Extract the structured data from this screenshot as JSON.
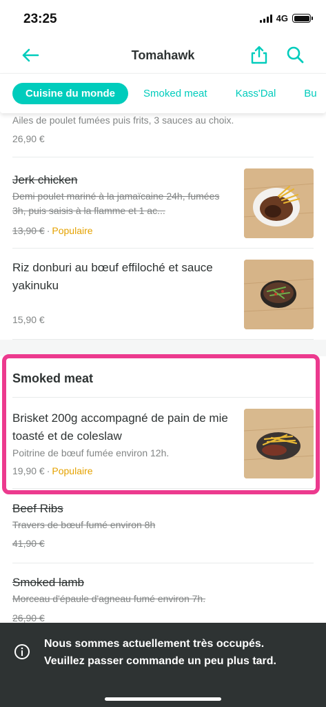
{
  "status_bar": {
    "time": "23:25",
    "network": "4G"
  },
  "header": {
    "title": "Tomahawk",
    "back_icon": "arrow-left-icon",
    "share_icon": "share-icon",
    "search_icon": "search-icon"
  },
  "tabs": [
    {
      "label": "Cuisine du monde",
      "active": true
    },
    {
      "label": "Smoked meat",
      "active": false
    },
    {
      "label": "Kass'Dal",
      "active": false
    },
    {
      "label": "Bu",
      "active": false
    }
  ],
  "items": [
    {
      "name": "",
      "description": "Ailes de poulet fumées puis frits, 3 sauces au choix.",
      "price": "26,90 €",
      "badge": "",
      "available": true
    },
    {
      "name": "Jerk chicken",
      "description": "Demi poulet mariné à la jamaïcaine 24h, fumées 3h, puis saisis à la flamme et 1 ac...",
      "price": "13,90 €",
      "badge": "Populaire",
      "available": false
    },
    {
      "name": "Riz donburi au bœuf effiloché et sauce yakinuku",
      "description": "",
      "price": "15,90 €",
      "badge": "",
      "available": true
    }
  ],
  "sections": [
    {
      "title": "Smoked meat",
      "items": [
        {
          "name": "Brisket 200g accompagné de pain de mie toasté et de coleslaw",
          "description": "Poitrine de bœuf fumée environ 12h.",
          "price": "19,90 €",
          "badge": "Populaire",
          "available": true
        },
        {
          "name": "Beef Ribs",
          "description": "Travers de bœuf fumé environ 8h",
          "price": "41,90 €",
          "badge": "",
          "available": false
        },
        {
          "name": "Smoked lamb",
          "description": "Morceau d'épaule d'agneau fumé environ 7h.",
          "price": "26,90 €",
          "badge": "",
          "available": false
        }
      ]
    }
  ],
  "banner": {
    "line1": "Nous sommes actuellement très occupés.",
    "line2": "Veuillez passer commande un peu plus tard.",
    "icon": "info-icon"
  },
  "colors": {
    "accent": "#00ccbc",
    "popular": "#e5a200",
    "highlight": "#ec3a8e",
    "banner_bg": "#2e3333"
  }
}
